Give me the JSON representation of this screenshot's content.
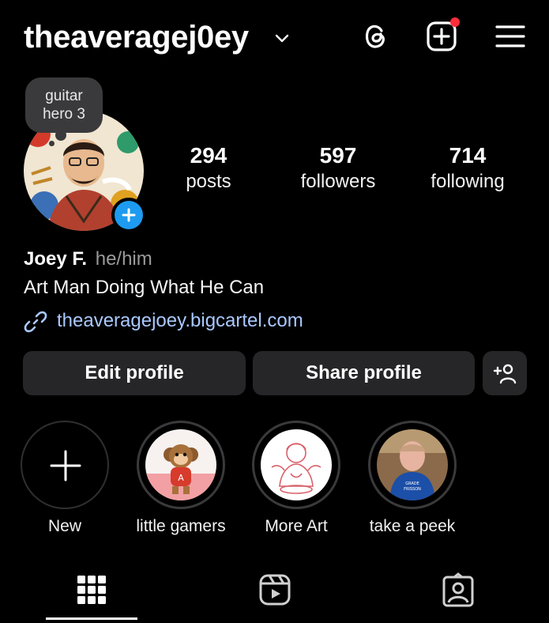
{
  "header": {
    "username": "theaveragej0ey",
    "icons": [
      "chevron-down-icon",
      "threads-icon",
      "new-post-icon",
      "menu-icon"
    ],
    "notification_dot_color": "#ff2d3b"
  },
  "note": {
    "line1": "guitar",
    "line2": "hero 3"
  },
  "stats": {
    "posts": {
      "value": "294",
      "label": "posts"
    },
    "followers": {
      "value": "597",
      "label": "followers"
    },
    "following": {
      "value": "714",
      "label": "following"
    }
  },
  "profile": {
    "name": "Joey F.",
    "pronouns": "he/him",
    "bio": "Art Man Doing What He Can",
    "link": "theaveragejoey.bigcartel.com"
  },
  "buttons": {
    "edit": "Edit profile",
    "share": "Share profile",
    "add_person_icon": "add-person-icon"
  },
  "highlights": [
    {
      "label": "New"
    },
    {
      "label": "little gamers"
    },
    {
      "label": "More Art"
    },
    {
      "label": "take a peek"
    }
  ],
  "tabs": [
    "grid-icon",
    "reels-icon",
    "tagged-icon"
  ],
  "colors": {
    "background": "#000000",
    "button": "#262628",
    "link": "#a9c9ff",
    "badge": "#1d9bf0"
  }
}
